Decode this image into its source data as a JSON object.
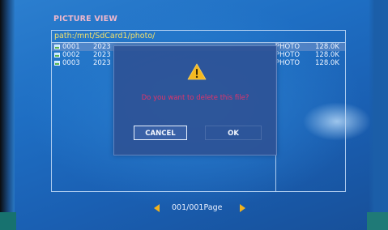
{
  "window": {
    "title": "PICTURE VIEW"
  },
  "browser": {
    "path": "path:/mnt/SdCard1/photo/",
    "files": [
      {
        "num": "0001",
        "date": "2023",
        "type": "PHOTO",
        "size": "128.0K",
        "selected": true
      },
      {
        "num": "0002",
        "date": "2023",
        "type": "PHOTO",
        "size": "128.0K",
        "selected": false
      },
      {
        "num": "0003",
        "date": "2023",
        "type": "PHOTO",
        "size": "128.0K",
        "selected": false
      }
    ]
  },
  "pager": {
    "text": "001/001Page",
    "prev_icon": "arrow-left-icon",
    "next_icon": "arrow-right-icon"
  },
  "dialog": {
    "icon": "warning-icon",
    "message": "Do you want to delete this file?",
    "cancel_label": "CANCEL",
    "ok_label": "OK"
  },
  "colors": {
    "title": "#f0b8cc",
    "path": "#f2e06a",
    "message": "#e2336a",
    "arrow": "#f2b21c",
    "warning": "#f5b820"
  }
}
